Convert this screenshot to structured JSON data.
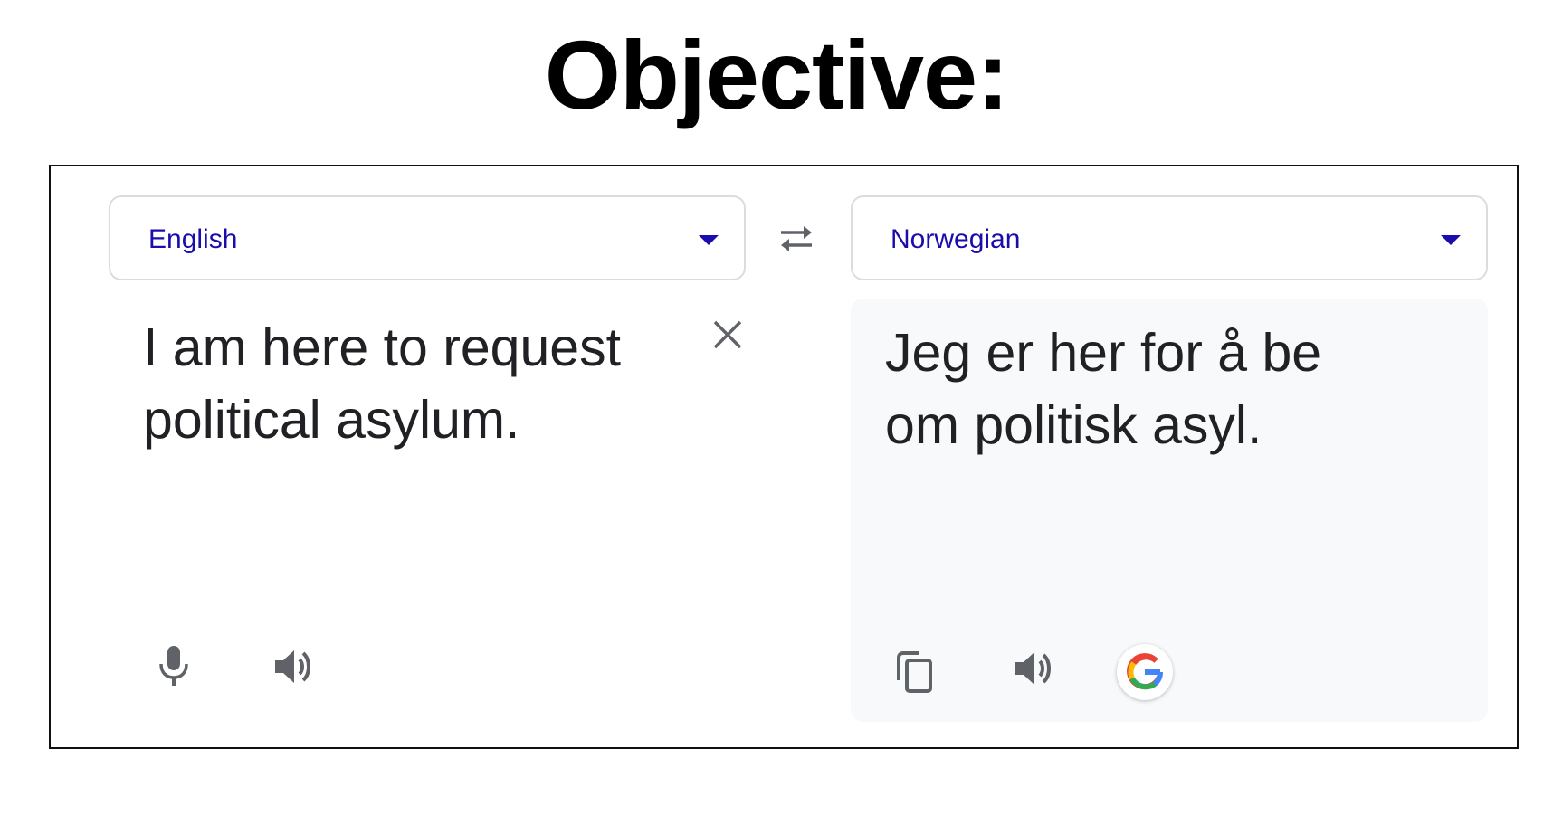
{
  "heading": "Objective:",
  "source": {
    "language": "English",
    "text_lines": [
      "I am here to request",
      "political asylum."
    ]
  },
  "target": {
    "language": "Norwegian",
    "text_lines": [
      "Jeg er her for å be",
      "om politisk asyl."
    ]
  },
  "icons": {
    "clear": "close-icon",
    "swap": "swap-languages-icon",
    "dropdown": "caret-down-icon",
    "microphone": "microphone-icon",
    "listen": "speaker-icon",
    "copy": "copy-icon",
    "google": "google-logo-icon"
  },
  "colors": {
    "language_link": "#1a0dab",
    "text": "#202124",
    "icon": "#5f6368",
    "target_panel_bg": "#f8f9fa"
  }
}
